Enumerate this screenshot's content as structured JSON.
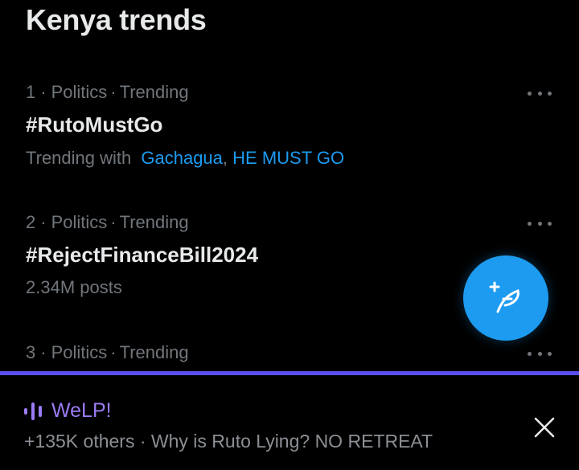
{
  "header": {
    "title": "Kenya trends"
  },
  "trends": [
    {
      "rank": "1",
      "category": "Politics",
      "status": "Trending",
      "name": "#RutoMustGo",
      "trending_with_label": "Trending with",
      "trending_with": [
        "Gachagua",
        "HE MUST GO"
      ]
    },
    {
      "rank": "2",
      "category": "Politics",
      "status": "Trending",
      "name": "#RejectFinanceBill2024",
      "posts": "2.34M posts"
    },
    {
      "rank": "3",
      "category": "Politics",
      "status": "Trending"
    }
  ],
  "meta_separator": "·",
  "compose": {
    "icon": "compose-feather-icon"
  },
  "space": {
    "title": "WeLP!",
    "subtitle": "+135K others · Why is Ruto Lying? NO RETREAT",
    "icon": "audio-wave-icon"
  },
  "icons": {
    "more": "more-dots-icon",
    "close": "close-icon"
  },
  "colors": {
    "background": "#000000",
    "primary_text": "#e7e9ea",
    "secondary_text": "#71767b",
    "link": "#1d9bf0",
    "accent_blue": "#1d9bf0",
    "space_purple": "#9b7cf5",
    "space_divider": "#5b4ef0"
  }
}
